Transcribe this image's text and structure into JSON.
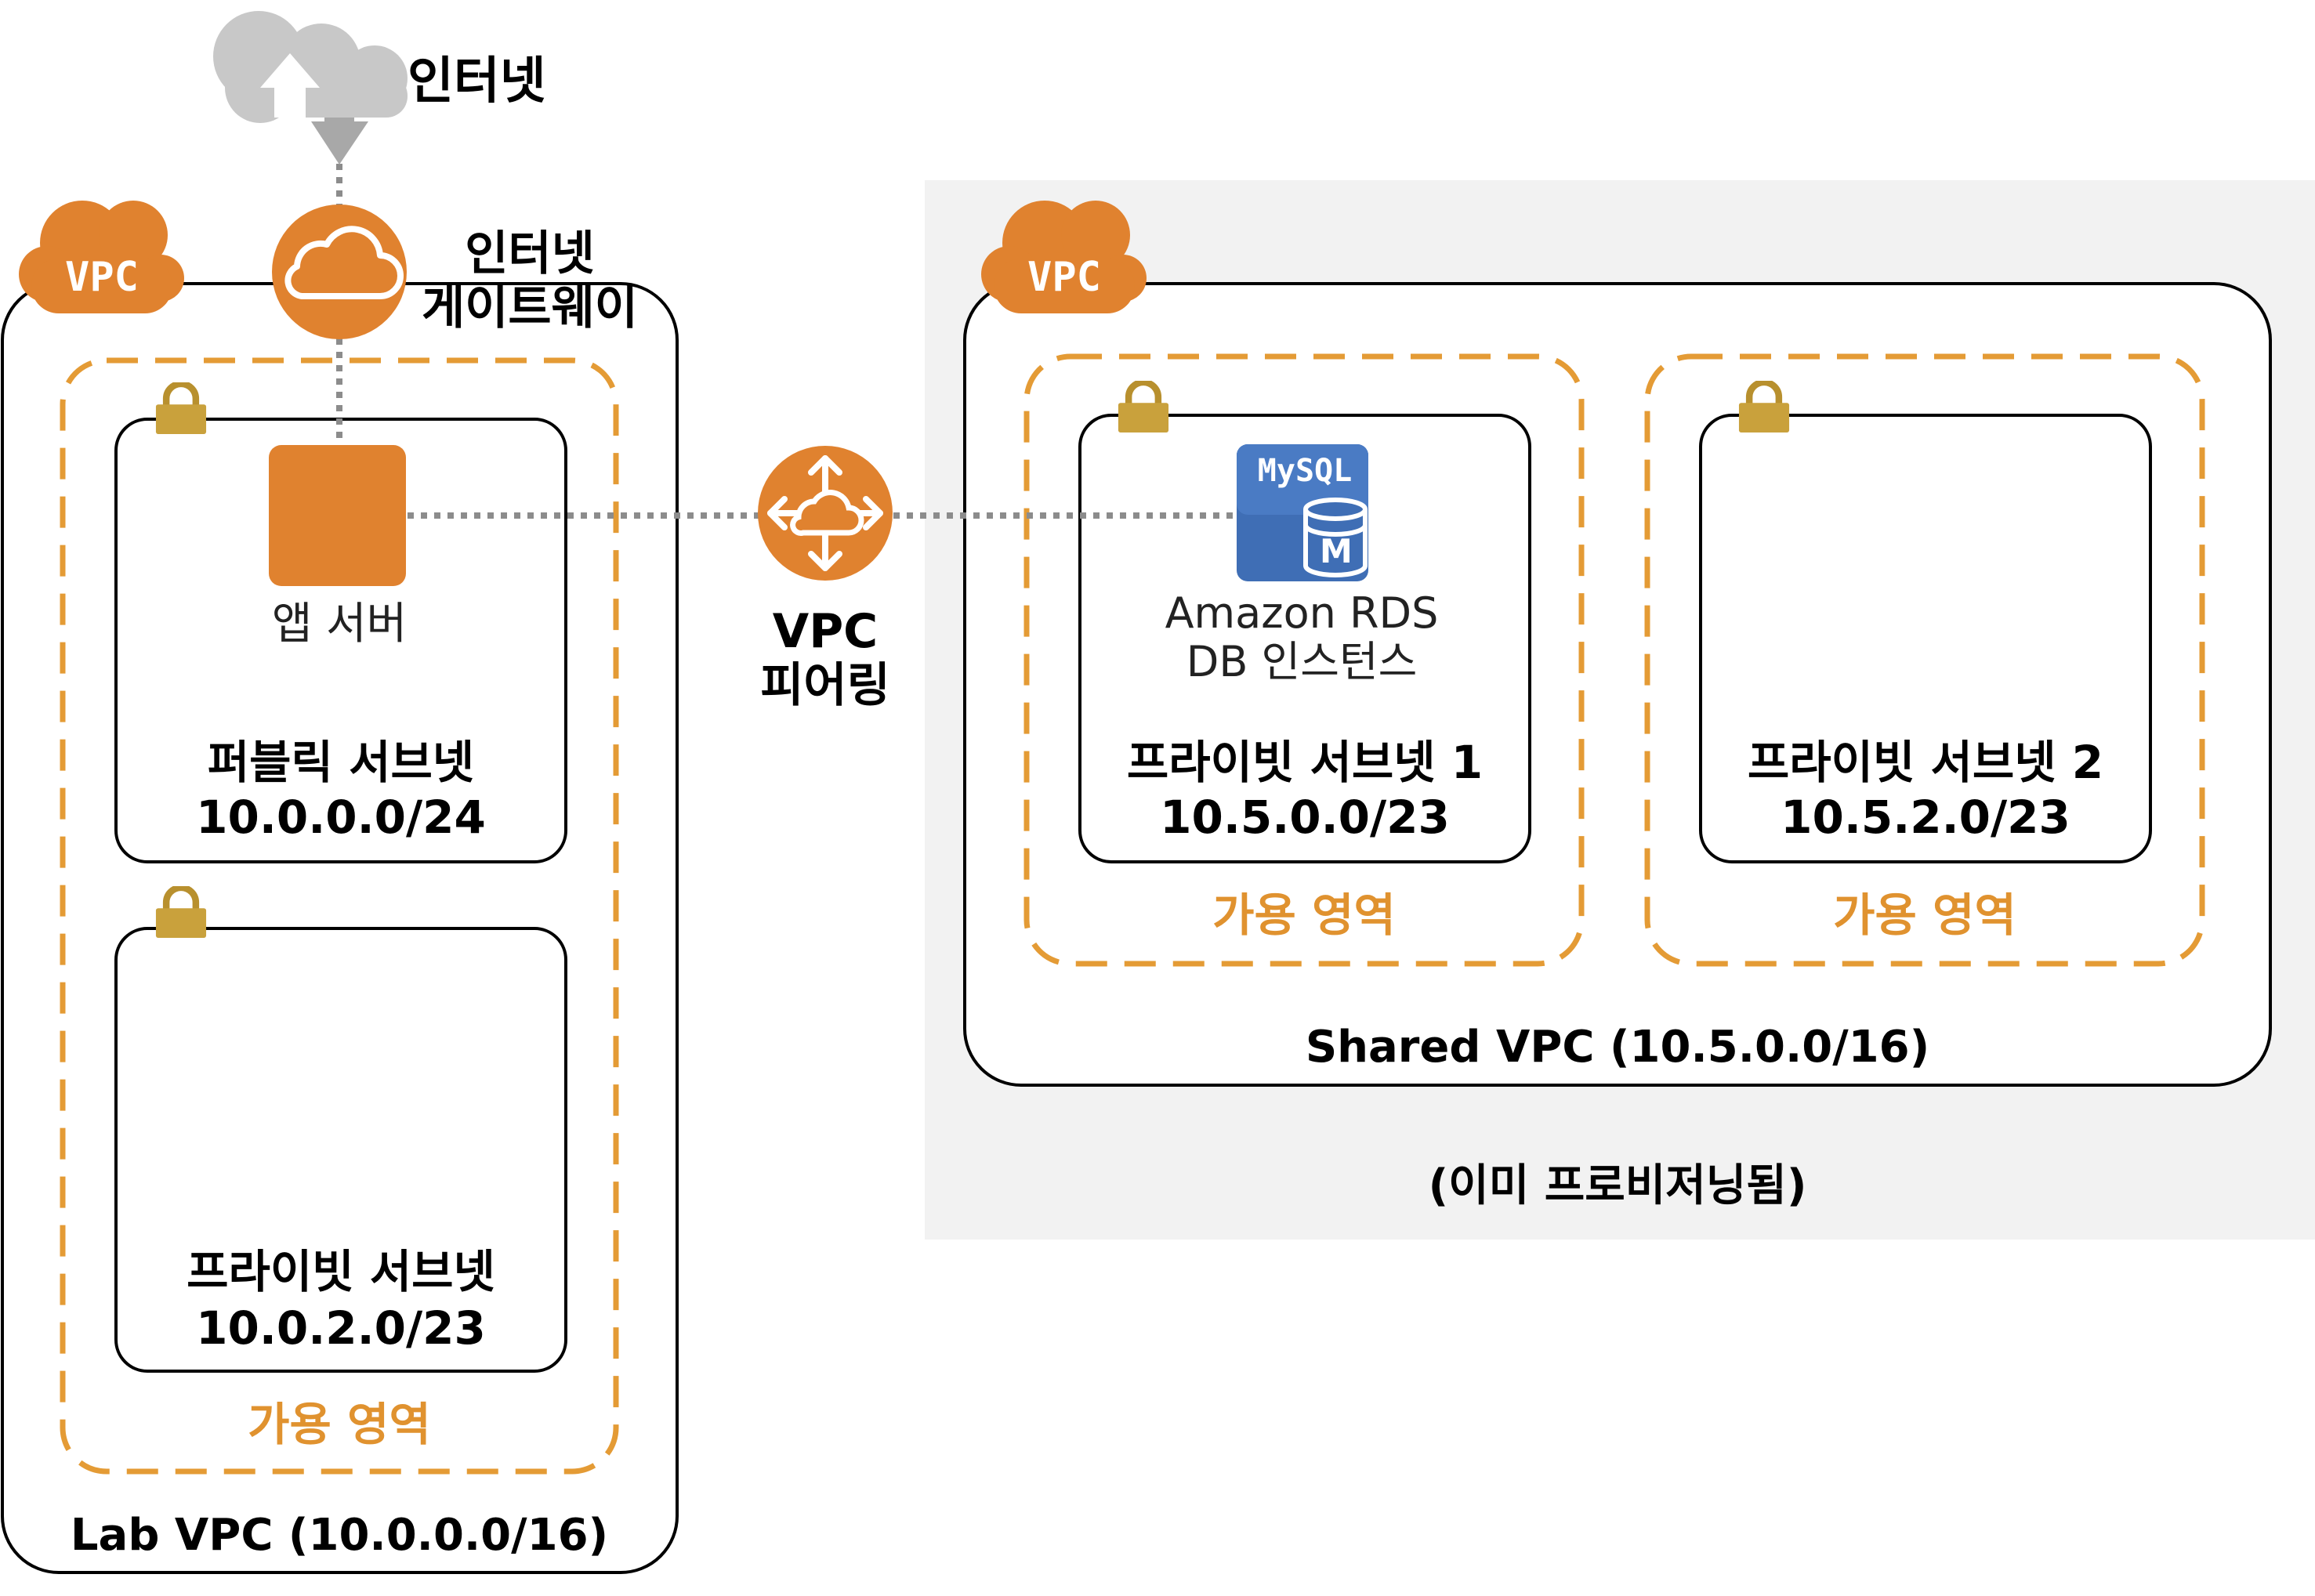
{
  "colors": {
    "accent_orange": "#E0822F",
    "az_border": "#E49B35",
    "lock_gold": "#C9A13C",
    "mysql_blue": "#3F6EB5",
    "shared_bg": "#F2F2F2",
    "cloud_gray": "#C8C8C8"
  },
  "internet": {
    "label": "인터넷",
    "icon": "cloud-upload-icon"
  },
  "igw": {
    "line1": "인터넷",
    "line2": "게이트웨이",
    "icon": "cloud-gateway-icon"
  },
  "lab_vpc": {
    "badge": "VPC",
    "label": "Lab VPC (10.0.0.0/16)",
    "az_label": "가용 영역",
    "public_subnet": {
      "name": "퍼블릭 서브넷",
      "cidr": "10.0.0.0/24"
    },
    "private_subnet": {
      "name": "프라이빗 서브넷",
      "cidr": "10.0.2.0/23"
    },
    "app_server": {
      "label": "앱 서버",
      "icon": "ec2-instance-icon"
    }
  },
  "peering": {
    "line1": "VPC",
    "line2": "피어링",
    "icon": "vpc-peering-router-icon"
  },
  "shared_vpc": {
    "badge": "VPC",
    "label": "Shared VPC (10.5.0.0/16)",
    "note": "(이미 프로비저닝됨)",
    "az1": {
      "label": "가용 영역",
      "subnet_name": "프라이빗 서브넷 1",
      "cidr": "10.5.0.0/23"
    },
    "az2": {
      "label": "가용 영역",
      "subnet_name": "프라이빗 서브넷 2",
      "cidr": "10.5.2.0/23"
    },
    "rds": {
      "icon_text": "MySQL",
      "icon_letter": "M",
      "line1": "Amazon RDS",
      "line2": "DB 인스턴스"
    }
  }
}
